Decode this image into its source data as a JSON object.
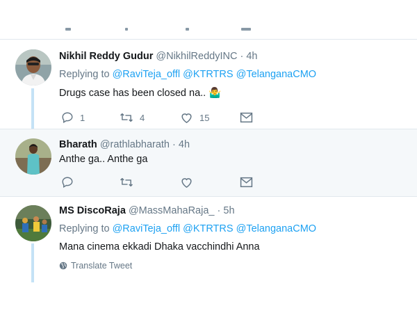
{
  "thread": {
    "tweets": [
      {
        "name": "Nikhil Reddy Gudur",
        "handle": "@NikhilReddyINC",
        "dot": "·",
        "time": "4h",
        "replying_prefix": "Replying to",
        "mentions": [
          "@RaviTeja_offl",
          "@KTRTRS",
          "@TelanganaCMO"
        ],
        "text": "Drugs case has been closed na..",
        "emoji": "🤷‍♂️",
        "reply_count": "1",
        "retweet_count": "4",
        "like_count": "15"
      },
      {
        "name": "Bharath",
        "handle": "@rathlabharath",
        "dot": "·",
        "time": "4h",
        "text": "Anthe ga.. Anthe ga",
        "reply_count": "",
        "retweet_count": "",
        "like_count": ""
      },
      {
        "name": "MS DiscoRaja",
        "handle": "@MassMahaRaja_",
        "dot": "·",
        "time": "5h",
        "replying_prefix": "Replying to",
        "mentions": [
          "@RaviTeja_offl",
          "@KTRTRS",
          "@TelanganaCMO"
        ],
        "text": "Mana cinema ekkadi Dhaka vacchindhi Anna",
        "translate_label": "Translate Tweet"
      }
    ]
  },
  "icons": {
    "reply": "reply-icon",
    "retweet": "retweet-icon",
    "like": "heart-icon",
    "dm": "envelope-icon",
    "translate": "globe-icon"
  },
  "colors": {
    "link": "#1da1f2",
    "muted": "#657786",
    "thread_line": "#c4e2f6",
    "highlight_bg": "#f5f8fa"
  }
}
